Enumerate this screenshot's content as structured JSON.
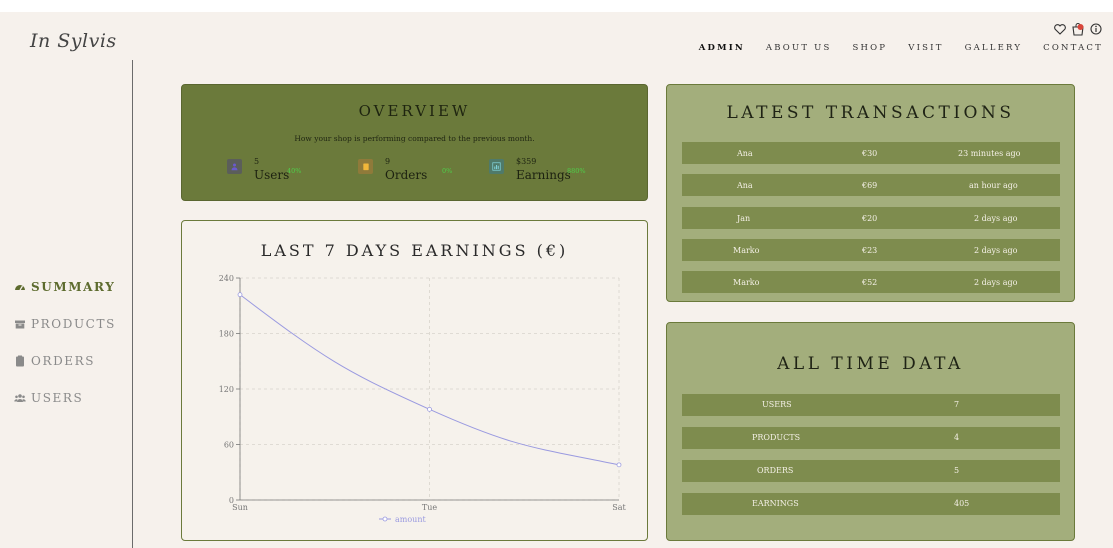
{
  "brand": {
    "logo": "In Sylvis"
  },
  "nav": [
    "ADMIN",
    "ABOUT US",
    "SHOP",
    "VISIT",
    "GALLERY",
    "CONTACT"
  ],
  "top_icons": [
    "heart-icon",
    "cart-icon",
    "info-icon"
  ],
  "sidebar": {
    "items": [
      {
        "label": "SUMMARY",
        "icon": "dashboard-icon",
        "active": true
      },
      {
        "label": "PRODUCTS",
        "icon": "box-icon",
        "active": false
      },
      {
        "label": "ORDERS",
        "icon": "clipboard-icon",
        "active": false
      },
      {
        "label": "USERS",
        "icon": "users-icon",
        "active": false
      }
    ]
  },
  "overview": {
    "title": "OVERVIEW",
    "subtitle": "How your shop is performing compared to the previous month.",
    "stats": [
      {
        "value": "5",
        "label": "Users",
        "change": "40%",
        "icon": "users-icon",
        "color": "#6a5acd"
      },
      {
        "value": "9",
        "label": "Orders",
        "change": "0%",
        "icon": "clipboard-icon",
        "color": "#e0a52a"
      },
      {
        "value": "$359",
        "label": "Earnings",
        "change": "880%",
        "icon": "chart-icon",
        "color": "#3a9ea5"
      }
    ]
  },
  "earnings": {
    "title": "LAST 7 DAYS EARNINGS (€)",
    "legend": "amount"
  },
  "chart_data": {
    "type": "line",
    "x": [
      "Sun",
      "Tue",
      "Sat"
    ],
    "series": [
      {
        "name": "amount",
        "values": [
          222,
          98,
          38
        ]
      }
    ],
    "ylim": [
      0,
      240
    ],
    "yticks": [
      0,
      60,
      120,
      180,
      240
    ],
    "grid": true,
    "legend": "bottom",
    "line_color": "#9a9ae0"
  },
  "latest": {
    "title": "LATEST TRANSACTIONS",
    "rows": [
      {
        "name": "Ana",
        "amount": "€30",
        "time": "23 minutes ago"
      },
      {
        "name": "Ana",
        "amount": "€69",
        "time": "an hour ago"
      },
      {
        "name": "Jan",
        "amount": "€20",
        "time": "2 days ago"
      },
      {
        "name": "Marko",
        "amount": "€23",
        "time": "2 days ago"
      },
      {
        "name": "Marko",
        "amount": "€52",
        "time": "2 days ago"
      }
    ]
  },
  "alltime": {
    "title": "ALL TIME DATA",
    "rows": [
      {
        "label": "USERS",
        "value": "7"
      },
      {
        "label": "PRODUCTS",
        "value": "4"
      },
      {
        "label": "ORDERS",
        "value": "5"
      },
      {
        "label": "EARNINGS",
        "value": "405"
      }
    ]
  }
}
